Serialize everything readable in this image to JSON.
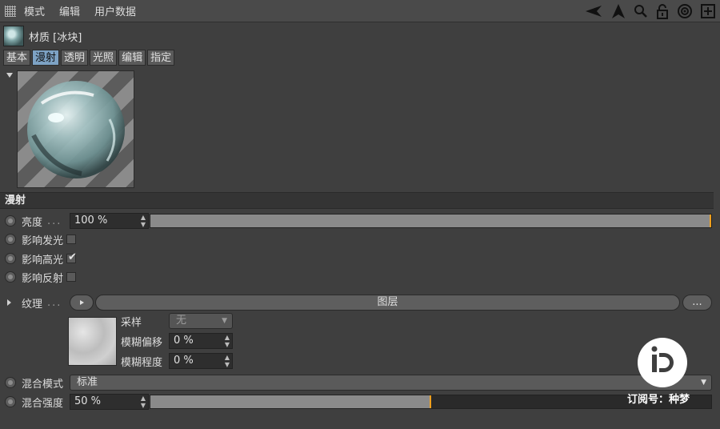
{
  "menubar": {
    "items": [
      "模式",
      "编辑",
      "用户数据"
    ],
    "tools": [
      "back-arrow-icon",
      "up-arrow-icon",
      "search-icon",
      "lock-icon",
      "target-icon",
      "add-icon"
    ]
  },
  "header": {
    "title": "材质 [冰块]"
  },
  "tabs": [
    {
      "label": "基本",
      "active": false
    },
    {
      "label": "漫射",
      "active": true
    },
    {
      "label": "透明",
      "active": false
    },
    {
      "label": "光照",
      "active": false
    },
    {
      "label": "编辑",
      "active": false
    },
    {
      "label": "指定",
      "active": false
    }
  ],
  "section": {
    "title": "漫射"
  },
  "brightness": {
    "label": "亮度",
    "dots": "...",
    "value": "100 %",
    "fill": 1.0
  },
  "affect_luminance": {
    "label": "影响发光",
    "checked": false
  },
  "affect_specular": {
    "label": "影响高光",
    "checked": true,
    "mark": "✔"
  },
  "affect_reflection": {
    "label": "影响反射",
    "checked": false
  },
  "texture": {
    "label": "纹理",
    "dots": "...",
    "layer_button": "图层",
    "more_button": "...",
    "sampling_label": "采样",
    "sampling_value": "无",
    "blur_offset_label": "模糊偏移",
    "blur_offset_value": "0 %",
    "blur_scale_label": "模糊程度",
    "blur_scale_value": "0 %"
  },
  "blend_mode": {
    "label": "混合模式",
    "value": "标准"
  },
  "blend_strength": {
    "label": "混合强度",
    "value": "50 %",
    "fill": 0.5
  },
  "watermark": {
    "text": "订阅号：种梦"
  },
  "colors": {
    "accent": "#7da2c4",
    "slider_knob": "#f0a020"
  }
}
